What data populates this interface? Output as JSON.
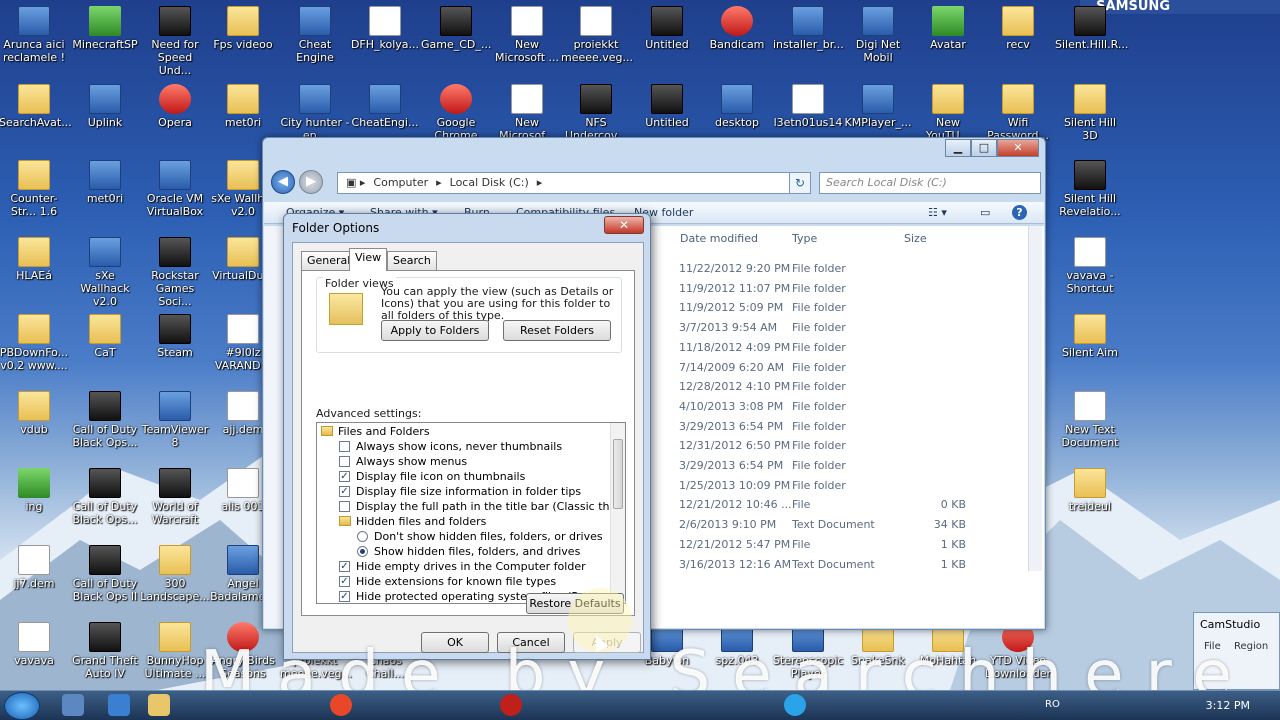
{
  "desktop": {
    "brand": "SAMSUNG",
    "icons": [
      {
        "label": "Arunca aici reclamele !",
        "kind": "app"
      },
      {
        "label": "MinecraftSP",
        "kind": "green"
      },
      {
        "label": "Need for Speed Und...",
        "kind": "dark"
      },
      {
        "label": "Fps videoo",
        "kind": "folder"
      },
      {
        "label": "Cheat Engine",
        "kind": "app"
      },
      {
        "label": "DFH_kolya...",
        "kind": "doc"
      },
      {
        "label": "Game_CD_...",
        "kind": "dark"
      },
      {
        "label": "New Microsoft ...",
        "kind": "doc"
      },
      {
        "label": "proiekkt meeee.veg...",
        "kind": "doc"
      },
      {
        "label": "Untitled",
        "kind": "dark"
      },
      {
        "label": "Bandicam",
        "kind": "red"
      },
      {
        "label": "installer_br...",
        "kind": "app"
      },
      {
        "label": "Digi Net Mobil",
        "kind": "app"
      },
      {
        "label": "Avatar",
        "kind": "green"
      },
      {
        "label": "recv",
        "kind": "folder"
      },
      {
        "label": "Silent.Hill.R...",
        "kind": "dark"
      },
      {
        "label": "SearchAvat...",
        "kind": "folder"
      },
      {
        "label": "Uplink",
        "kind": "app"
      },
      {
        "label": "Opera",
        "kind": "red"
      },
      {
        "label": "met0ri",
        "kind": "folder"
      },
      {
        "label": "City hunter - ep...",
        "kind": "app"
      },
      {
        "label": "CheatEngi...",
        "kind": "app"
      },
      {
        "label": "Google Chrome",
        "kind": "red"
      },
      {
        "label": "New Microsof...",
        "kind": "doc"
      },
      {
        "label": "NFS Undercov...",
        "kind": "dark"
      },
      {
        "label": "Untitled",
        "kind": "dark"
      },
      {
        "label": "desktop",
        "kind": "app"
      },
      {
        "label": "l3etn01us14",
        "kind": "doc"
      },
      {
        "label": "KMPlayer_...",
        "kind": "app"
      },
      {
        "label": "New YouTU...",
        "kind": "folder"
      },
      {
        "label": "Wifi Password...",
        "kind": "folder"
      },
      {
        "label": "Silent Hill 3D",
        "kind": "folder"
      },
      {
        "label": "Counter-Str... 1.6",
        "kind": "folder"
      },
      {
        "label": "met0ri",
        "kind": "app"
      },
      {
        "label": "Oracle VM VirtualBox",
        "kind": "app"
      },
      {
        "label": "sXe Wallh... v2.0",
        "kind": "folder"
      },
      {
        "label": "Silent Hill Revelatio...",
        "kind": "dark"
      },
      {
        "label": "HLAEá",
        "kind": "folder"
      },
      {
        "label": "sXe Wallhack v2.0",
        "kind": "app"
      },
      {
        "label": "Rockstar Games Soci...",
        "kind": "dark"
      },
      {
        "label": "VirtualDu...",
        "kind": "folder"
      },
      {
        "label": "vavava - Shortcut",
        "kind": "doc"
      },
      {
        "label": "PBDownFo... v0.2 www....",
        "kind": "folder"
      },
      {
        "label": "CaT",
        "kind": "folder"
      },
      {
        "label": "Steam",
        "kind": "dark"
      },
      {
        "label": "#9l0lz VARAND...",
        "kind": "doc"
      },
      {
        "label": "Silent Aim",
        "kind": "folder"
      },
      {
        "label": "vdub",
        "kind": "folder"
      },
      {
        "label": "Call of Duty Black Ops...",
        "kind": "dark"
      },
      {
        "label": "TeamViewer 8",
        "kind": "app"
      },
      {
        "label": "ajj.dem",
        "kind": "doc"
      },
      {
        "label": "New Text Document",
        "kind": "doc"
      },
      {
        "label": "ing",
        "kind": "green"
      },
      {
        "label": "Call of Duty Black Ops...",
        "kind": "dark"
      },
      {
        "label": "World of Warcraft",
        "kind": "dark"
      },
      {
        "label": "alis 001",
        "kind": "doc"
      },
      {
        "label": "treideul",
        "kind": "folder"
      },
      {
        "label": "jj7.dem",
        "kind": "doc"
      },
      {
        "label": "Call of Duty Black Ops II",
        "kind": "dark"
      },
      {
        "label": "300 Landscape...",
        "kind": "folder"
      },
      {
        "label": "Angel Badalame...",
        "kind": "app"
      },
      {
        "label": "vavava",
        "kind": "doc"
      },
      {
        "label": "Grand Theft Auto IV",
        "kind": "dark"
      },
      {
        "label": "BunnyHop Ultimate ...",
        "kind": "folder"
      },
      {
        "label": "Angry Birds Seasons",
        "kind": "red"
      },
      {
        "label": "proiekkt meeee.veg...",
        "kind": "doc"
      },
      {
        "label": "Chaos Chall...",
        "kind": "app"
      },
      {
        "label": "Babylon",
        "kind": "app"
      },
      {
        "label": "spz.043",
        "kind": "app"
      },
      {
        "label": "Stereoscopic Player",
        "kind": "app"
      },
      {
        "label": "SnakeSnk",
        "kind": "folder"
      },
      {
        "label": "MoHahtah",
        "kind": "folder"
      },
      {
        "label": "YTD Video Downloader",
        "kind": "red"
      }
    ]
  },
  "explorer": {
    "window_buttons": {
      "minimize": "▁",
      "maximize": "□",
      "close": "✕"
    },
    "breadcrumb": [
      "Computer",
      "Local Disk (C:)"
    ],
    "search_placeholder": "Search Local Disk (C:)",
    "toolbar": {
      "organize": "Organize ▾",
      "share": "Share with ▾",
      "burn": "Burn",
      "compat": "Compatibility files",
      "newfolder": "New folder"
    },
    "columns": {
      "date": "Date modified",
      "type": "Type",
      "size": "Size"
    },
    "rows": [
      {
        "date": "11/22/2012 9:20 PM",
        "type": "File folder",
        "size": ""
      },
      {
        "date": "11/9/2012 11:07 PM",
        "type": "File folder",
        "size": ""
      },
      {
        "date": "11/9/2012 5:09 PM",
        "type": "File folder",
        "size": ""
      },
      {
        "date": "3/7/2013 9:54 AM",
        "type": "File folder",
        "size": ""
      },
      {
        "date": "11/18/2012 4:09 PM",
        "type": "File folder",
        "size": ""
      },
      {
        "date": "7/14/2009 6:20 AM",
        "type": "File folder",
        "size": ""
      },
      {
        "date": "12/28/2012 4:10 PM",
        "type": "File folder",
        "size": ""
      },
      {
        "date": "4/10/2013 3:08 PM",
        "type": "File folder",
        "size": ""
      },
      {
        "date": "3/29/2013 6:54 PM",
        "type": "File folder",
        "size": ""
      },
      {
        "date": "12/31/2012 6:50 PM",
        "type": "File folder",
        "size": ""
      },
      {
        "date": "3/29/2013 6:54 PM",
        "type": "File folder",
        "size": ""
      },
      {
        "date": "1/25/2013 10:09 PM",
        "type": "File folder",
        "size": ""
      },
      {
        "date": "12/21/2012 10:46 ...",
        "type": "File",
        "size": "0 KB"
      },
      {
        "date": "2/6/2013 9:10 PM",
        "type": "Text Document",
        "size": "34 KB"
      },
      {
        "date": "12/21/2012 5:47 PM",
        "type": "File",
        "size": "1 KB"
      },
      {
        "date": "3/16/2013 12:16 AM",
        "type": "Text Document",
        "size": "1 KB"
      }
    ]
  },
  "dialog": {
    "title": "Folder Options",
    "close": "✕",
    "tabs": [
      "General",
      "View",
      "Search"
    ],
    "folder_views": {
      "label": "Folder views",
      "text": "You can apply the view (such as Details or Icons) that you are using for this folder to all folders of this type.",
      "apply": "Apply to Folders",
      "reset": "Reset Folders"
    },
    "advanced_label": "Advanced settings:",
    "tree": [
      {
        "kind": "folder",
        "indent": 0,
        "label": "Files and Folders"
      },
      {
        "kind": "check",
        "indent": 1,
        "checked": false,
        "label": "Always show icons, never thumbnails"
      },
      {
        "kind": "check",
        "indent": 1,
        "checked": false,
        "label": "Always show menus"
      },
      {
        "kind": "check",
        "indent": 1,
        "checked": true,
        "label": "Display file icon on thumbnails"
      },
      {
        "kind": "check",
        "indent": 1,
        "checked": true,
        "label": "Display file size information in folder tips"
      },
      {
        "kind": "check",
        "indent": 1,
        "checked": false,
        "label": "Display the full path in the title bar (Classic theme only)"
      },
      {
        "kind": "folder",
        "indent": 1,
        "label": "Hidden files and folders"
      },
      {
        "kind": "radio",
        "indent": 2,
        "checked": false,
        "label": "Don't show hidden files, folders, or drives"
      },
      {
        "kind": "radio",
        "indent": 2,
        "checked": true,
        "label": "Show hidden files, folders, and drives"
      },
      {
        "kind": "check",
        "indent": 1,
        "checked": true,
        "label": "Hide empty drives in the Computer folder"
      },
      {
        "kind": "check",
        "indent": 1,
        "checked": true,
        "label": "Hide extensions for known file types"
      },
      {
        "kind": "check",
        "indent": 1,
        "checked": true,
        "label": "Hide protected operating system files (Recommended)"
      }
    ],
    "restore": "Restore Defaults",
    "ok": "OK",
    "cancel": "Cancel",
    "apply": "Apply"
  },
  "camstudio": {
    "title": "CamStudio",
    "menu": [
      "File",
      "Region"
    ]
  },
  "taskbar": {
    "lang": "RO",
    "clock": "3:12 PM"
  },
  "watermark": "Made by Searchhere"
}
